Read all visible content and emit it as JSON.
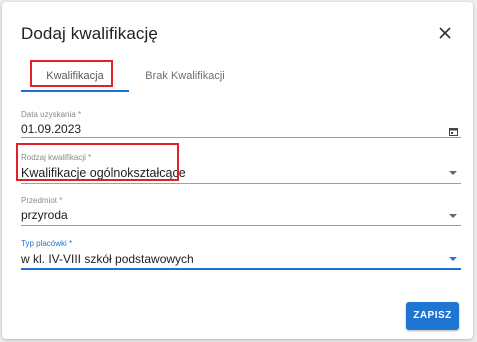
{
  "dialog": {
    "title": "Dodaj kwalifikację",
    "close_icon": "close-icon"
  },
  "tabs": [
    {
      "label": "Kwalifikacja",
      "active": true
    },
    {
      "label": "Brak Kwalifikacji",
      "active": false
    }
  ],
  "fields": {
    "date": {
      "label": "Data uzyskania",
      "required_mark": "*",
      "value": "01.09.2023",
      "icon": "calendar-icon"
    },
    "qualification_type": {
      "label": "Rodzaj kwalifikacji",
      "required_mark": "*",
      "value": "Kwalifikacje ogólnokształcące"
    },
    "subject": {
      "label": "Przedmiot",
      "required_mark": "*",
      "value": "przyroda"
    },
    "school_type": {
      "label": "Typ placówki",
      "required_mark": "*",
      "value": "w kl. IV-VIII szkół podstawowych"
    }
  },
  "buttons": {
    "save_label": "ZAPISZ"
  },
  "colors": {
    "accent": "#1976d2",
    "highlight": "#e0202a"
  }
}
